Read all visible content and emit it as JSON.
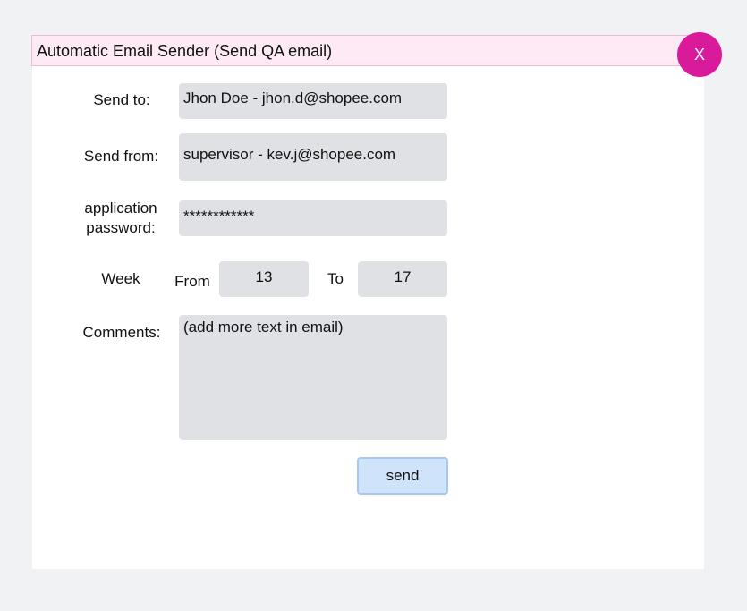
{
  "window": {
    "title": "Automatic Email Sender (Send QA email)",
    "close_label": "X"
  },
  "form": {
    "send_to": {
      "label": "Send to:",
      "value": "Jhon Doe - jhon.d@shopee.com"
    },
    "send_from": {
      "label": "Send from:",
      "value": "supervisor - kev.j@shopee.com"
    },
    "app_password": {
      "label_line1": "application",
      "label_line2": "password:",
      "value": "************"
    },
    "week": {
      "label": "Week",
      "from_label": "From",
      "from_value": "13",
      "to_label": "To",
      "to_value": "17"
    },
    "comments": {
      "label": "Comments:",
      "value": "(add more text in email)"
    },
    "send_label": "send"
  },
  "colors": {
    "close_button": "#d91b9b",
    "title_bar": "#fdeaf5",
    "field_bg": "#dfe1e5",
    "send_button": "#cfe3fb"
  }
}
